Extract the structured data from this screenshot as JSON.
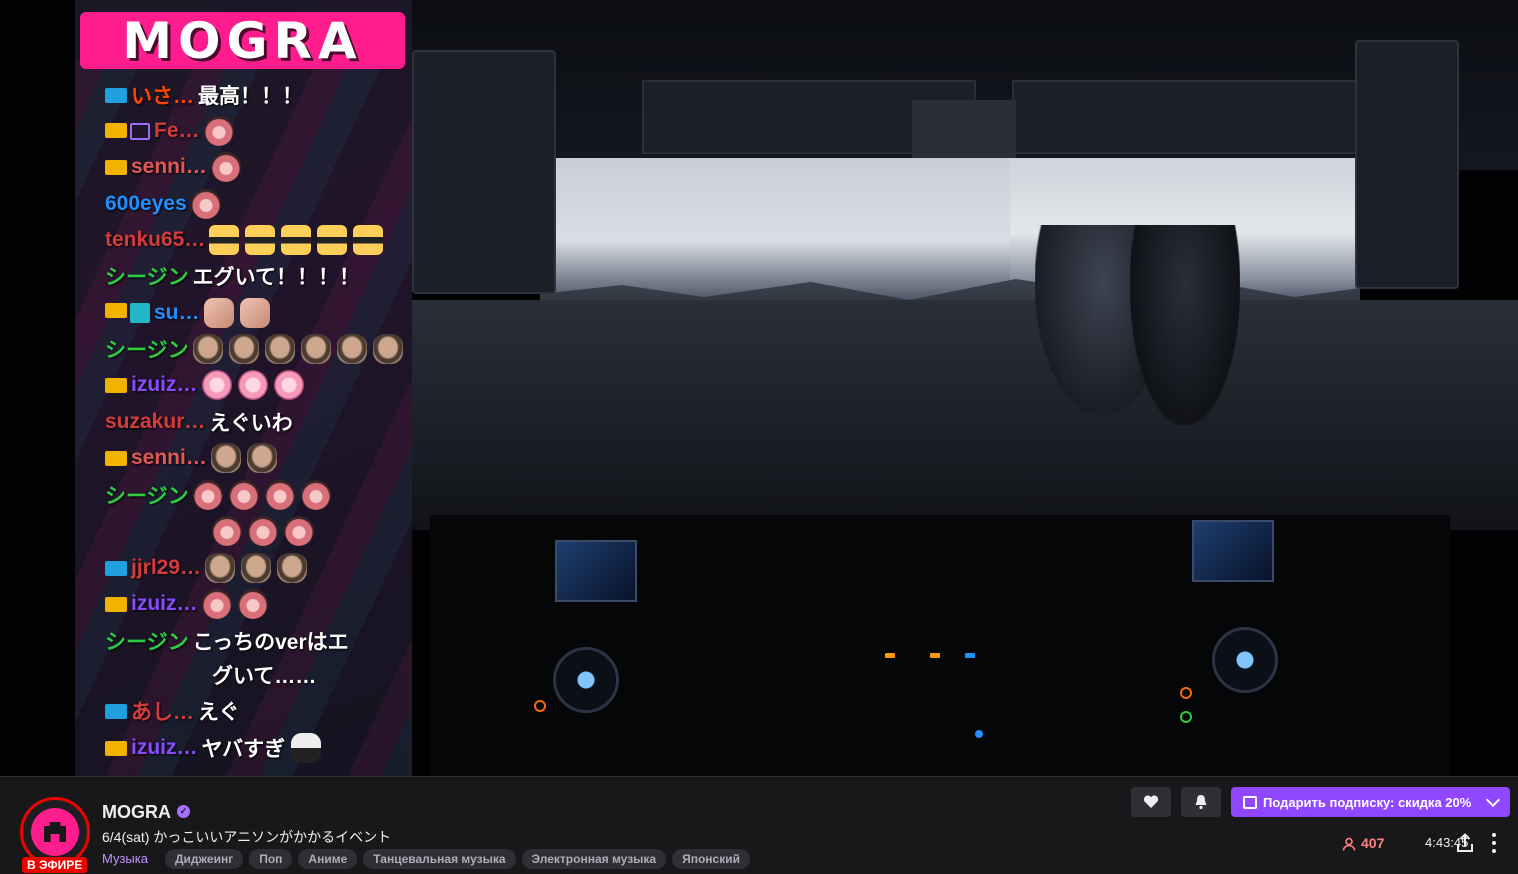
{
  "overlay": {
    "logo_text": "MOGRA",
    "messages": [
      {
        "user": "いさ…",
        "color": "#ff4500",
        "badges": [
          "blue"
        ],
        "text": "最高！！！",
        "emotes": []
      },
      {
        "user": "Fe…",
        "color": "#d43c3c",
        "badges": [
          "sub",
          "purp"
        ],
        "text": "",
        "emotes": [
          "bird"
        ]
      },
      {
        "user": "senni…",
        "color": "#e05a55",
        "badges": [
          "sub"
        ],
        "text": "",
        "emotes": [
          "bird"
        ]
      },
      {
        "user": "600eyes",
        "color": "#1e90ff",
        "badges": [],
        "text": "",
        "emotes": [
          "bird"
        ]
      },
      {
        "user": "tenku65…",
        "color": "#d43c3c",
        "badges": [],
        "text": "",
        "emotes": [
          "cat",
          "cat",
          "cat",
          "cat",
          "cat"
        ]
      },
      {
        "user": "シージン",
        "color": "#2ecc40",
        "badges": [],
        "text": "エグいて！！！！",
        "emotes": []
      },
      {
        "user": "su…",
        "color": "#1e90ff",
        "badges": [
          "sub",
          "teal"
        ],
        "text": "",
        "emotes": [
          "hand",
          "hand"
        ]
      },
      {
        "user": "シージン",
        "color": "#2ecc40",
        "badges": [],
        "text": "",
        "emotes": [
          "face",
          "face",
          "face",
          "face",
          "face",
          "face"
        ]
      },
      {
        "user": "izuiz…",
        "color": "#8a4bff",
        "badges": [
          "sub"
        ],
        "text": "",
        "emotes": [
          "shell",
          "shell",
          "shell"
        ]
      },
      {
        "user": "suzakur…",
        "color": "#d43c3c",
        "badges": [],
        "text": "えぐいわ",
        "emotes": []
      },
      {
        "user": "senni…",
        "color": "#e05a55",
        "badges": [
          "sub"
        ],
        "text": "",
        "emotes": [
          "face",
          "face"
        ]
      },
      {
        "user": "シージン",
        "color": "#2ecc40",
        "badges": [],
        "text": "",
        "emotes": [
          "bird",
          "bird",
          "bird",
          "bird"
        ]
      },
      {
        "user": "",
        "color": "#2ecc40",
        "badges": [],
        "text": "",
        "emotes": [
          "bird",
          "bird",
          "bird"
        ]
      },
      {
        "user": "jjrl29…",
        "color": "#d43c3c",
        "badges": [
          "blue"
        ],
        "text": "",
        "emotes": [
          "face",
          "face",
          "face"
        ]
      },
      {
        "user": "izuiz…",
        "color": "#8a4bff",
        "badges": [
          "sub"
        ],
        "text": "",
        "emotes": [
          "bird",
          "bird"
        ]
      },
      {
        "user": "シージン",
        "color": "#2ecc40",
        "badges": [],
        "text": "こっちのverはエ",
        "emotes": []
      },
      {
        "user": "",
        "color": "#2ecc40",
        "badges": [],
        "text": "グいて……",
        "emotes": []
      },
      {
        "user": "あし…",
        "color": "#d43c3c",
        "badges": [
          "blue"
        ],
        "text": "えぐ",
        "emotes": []
      },
      {
        "user": "izuiz…",
        "color": "#8a4bff",
        "badges": [
          "sub"
        ],
        "text": "ヤバすぎ",
        "emotes": [
          "ghost"
        ]
      }
    ]
  },
  "channel": {
    "name": "MOGRA",
    "live_label": "В ЭФИРЕ",
    "title": "6/4(sat) かっこいいアニソンがかかるイベント",
    "category": "Музыка",
    "tags": [
      "Диджеинг",
      "Поп",
      "Аниме",
      "Танцевальная музыка",
      "Электронная музыка",
      "Японский"
    ],
    "viewers": "407",
    "uptime": "4:43:45",
    "gift_label": "Подарить подписку: скидка 20%"
  },
  "colors": {
    "brand_pink": "#ff1c8d",
    "twitch_purple": "#9147ff",
    "live_red": "#eb0400",
    "viewer_red": "#ff8280"
  },
  "icons": [
    "heart-icon",
    "bell-icon",
    "gift-icon",
    "chevron-down-icon",
    "viewer-icon",
    "share-icon",
    "more-icon",
    "verified-icon"
  ]
}
